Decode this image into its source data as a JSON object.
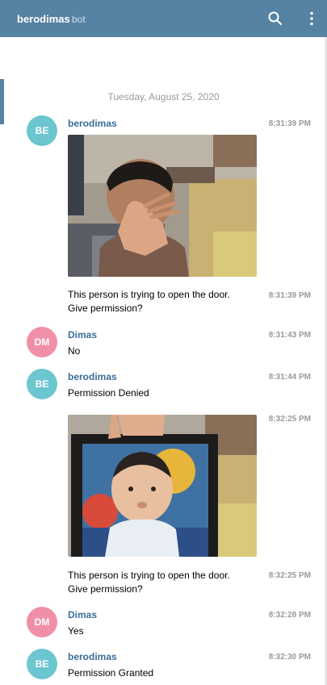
{
  "header": {
    "title": "berodimas",
    "subtitle": "bot",
    "search_icon": "search-icon",
    "menu_icon": "more-vertical-icon"
  },
  "colors": {
    "header_bg": "#5682a3",
    "author_name": "#3a6d99",
    "avatar_bot": "#6bc6cf",
    "avatar_user": "#f18fa9",
    "muted_text": "#999999"
  },
  "date_separator": "Tuesday, August 25, 2020",
  "messages": [
    {
      "author": "berodimas",
      "avatar": "BE",
      "time": "8:31:39 PM",
      "type": "photo"
    },
    {
      "text": "This person is trying to open the door.\nGive permission?",
      "time": "8:31:39 PM"
    },
    {
      "author": "Dimas",
      "avatar": "DM",
      "time": "8:31:43 PM",
      "text": "No"
    },
    {
      "author": "berodimas",
      "avatar": "BE",
      "time": "8:31:44 PM",
      "text": "Permission Denied"
    },
    {
      "time": "8:32:25 PM",
      "type": "photo"
    },
    {
      "text": "This person is trying to open the door.\nGive permission?",
      "time": "8:32:25 PM"
    },
    {
      "author": "Dimas",
      "avatar": "DM",
      "time": "8:32:28 PM",
      "text": "Yes"
    },
    {
      "author": "berodimas",
      "avatar": "BE",
      "time": "8:32:30 PM",
      "text": "Permission Granted"
    }
  ]
}
